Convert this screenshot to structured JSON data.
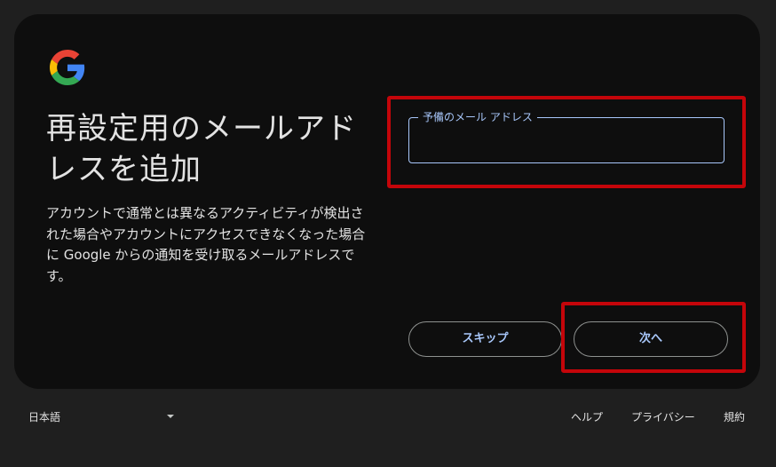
{
  "brand": {
    "logo_icon": "google-g-icon",
    "colors": {
      "blue": "#4285F4",
      "red": "#EA4335",
      "yellow": "#FBBC05",
      "green": "#34A853"
    }
  },
  "card": {
    "title": "再設定用のメールアドレスを追加",
    "description": "アカウントで通常とは異なるアクティビティが検出された場合やアカウントにアクセスできなくなった場合に Google からの通知を受け取るメールアドレスです。"
  },
  "email_field": {
    "label": "予備のメール アドレス",
    "value": ""
  },
  "actions": {
    "skip_label": "スキップ",
    "next_label": "次へ"
  },
  "footer": {
    "language": "日本語",
    "help": "ヘルプ",
    "privacy": "プライバシー",
    "terms": "規約"
  },
  "theme": {
    "background": "#1f1f1f",
    "card_background": "#0e0e0e",
    "accent": "#a8c7fa",
    "highlight": "#c4050a"
  }
}
